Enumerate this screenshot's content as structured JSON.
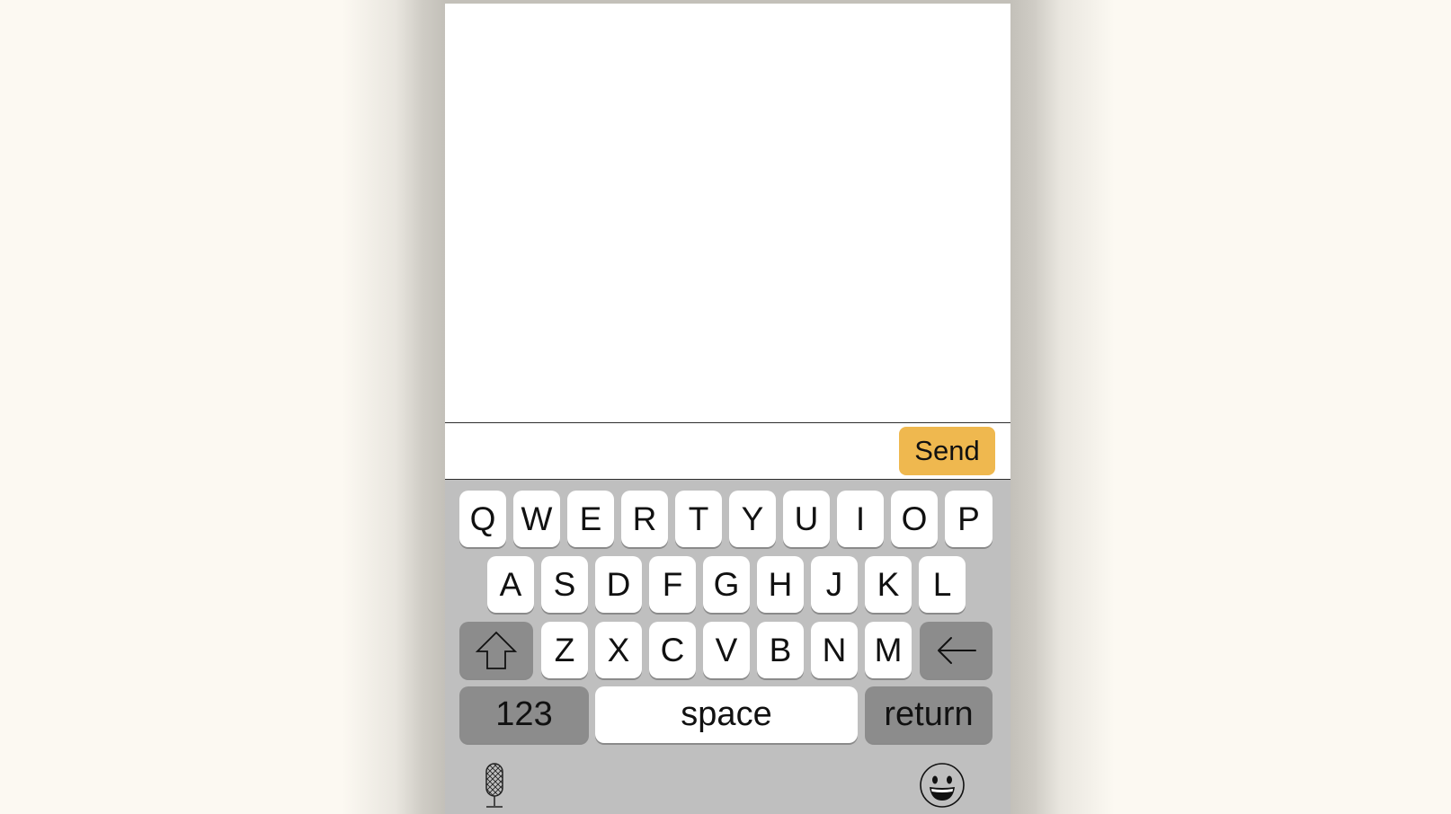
{
  "compose": {
    "input_value": "",
    "input_placeholder": "",
    "send_label": "Send"
  },
  "keyboard": {
    "row1": [
      "Q",
      "W",
      "E",
      "R",
      "T",
      "Y",
      "U",
      "I",
      "O",
      "P"
    ],
    "row2": [
      "A",
      "S",
      "D",
      "F",
      "G",
      "H",
      "J",
      "K",
      "L"
    ],
    "row3": [
      "Z",
      "X",
      "C",
      "V",
      "B",
      "N",
      "M"
    ],
    "numbers_label": "123",
    "space_label": "space",
    "return_label": "return",
    "shift_icon": "shift-arrow-icon",
    "backspace_icon": "left-arrow-icon",
    "dictation_icon": "microphone-icon",
    "emoji_icon": "smiley-face-icon"
  },
  "colors": {
    "send_button": "#efb84f",
    "keyboard_bg": "#bfbfbf",
    "dark_key": "#8c8c8c",
    "light_key": "#ffffff"
  }
}
